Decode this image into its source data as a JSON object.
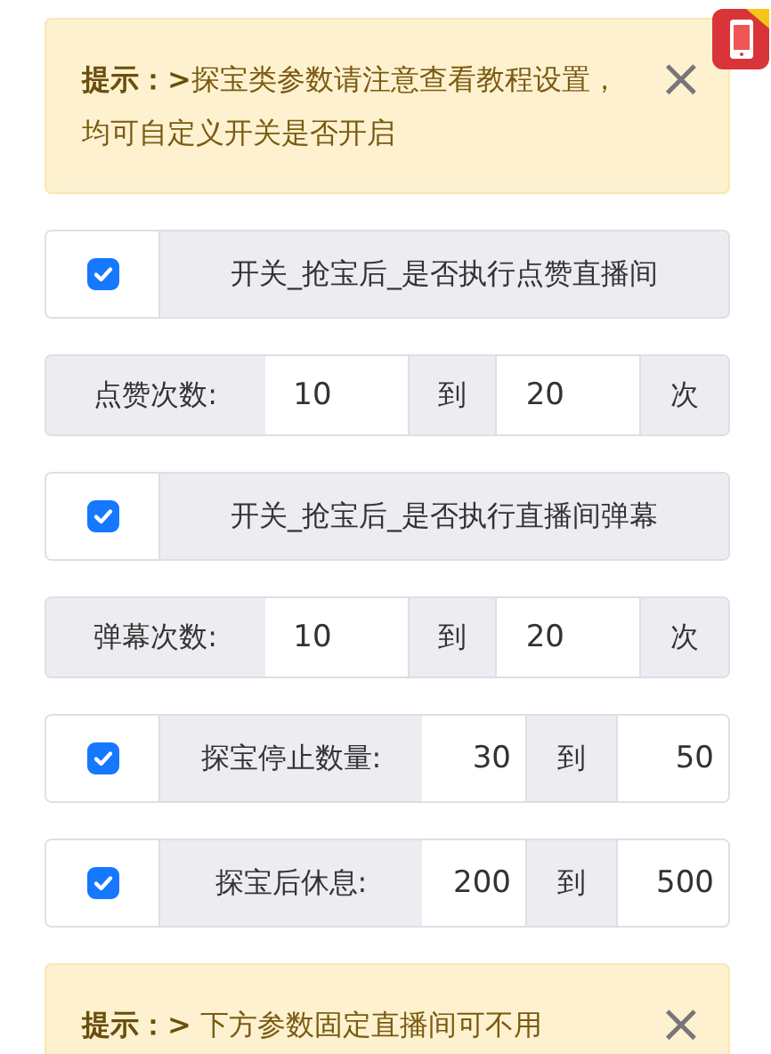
{
  "app_badge": {
    "kind": "app-icon"
  },
  "sections": [
    {
      "kind": "alert",
      "text": "**提示：>**探宝类参数请注意查看教程设置，均可自定义开关是否开启",
      "close": "×"
    },
    {
      "kind": "switch",
      "checked": true,
      "label": "开关_抢宝后_是否执行点赞直播间"
    },
    {
      "kind": "range",
      "label": "点赞次数:",
      "from": "10",
      "sep": "到",
      "to": "20",
      "unit": "次"
    },
    {
      "kind": "switch",
      "checked": true,
      "label": "开关_抢宝后_是否执行直播间弹幕"
    },
    {
      "kind": "range",
      "label": "弹幕次数:",
      "from": "10",
      "sep": "到",
      "to": "20",
      "unit": "次"
    },
    {
      "kind": "checked_range",
      "checked": true,
      "label": "探宝停止数量:",
      "from": "30",
      "sep": "到",
      "to": "50"
    },
    {
      "kind": "checked_range",
      "checked": true,
      "label": "探宝后休息:",
      "from": "200",
      "sep": "到",
      "to": "500"
    },
    {
      "kind": "alert",
      "text": "**提示：>** 下方参数固定直播间可不用",
      "close": "×"
    }
  ]
}
